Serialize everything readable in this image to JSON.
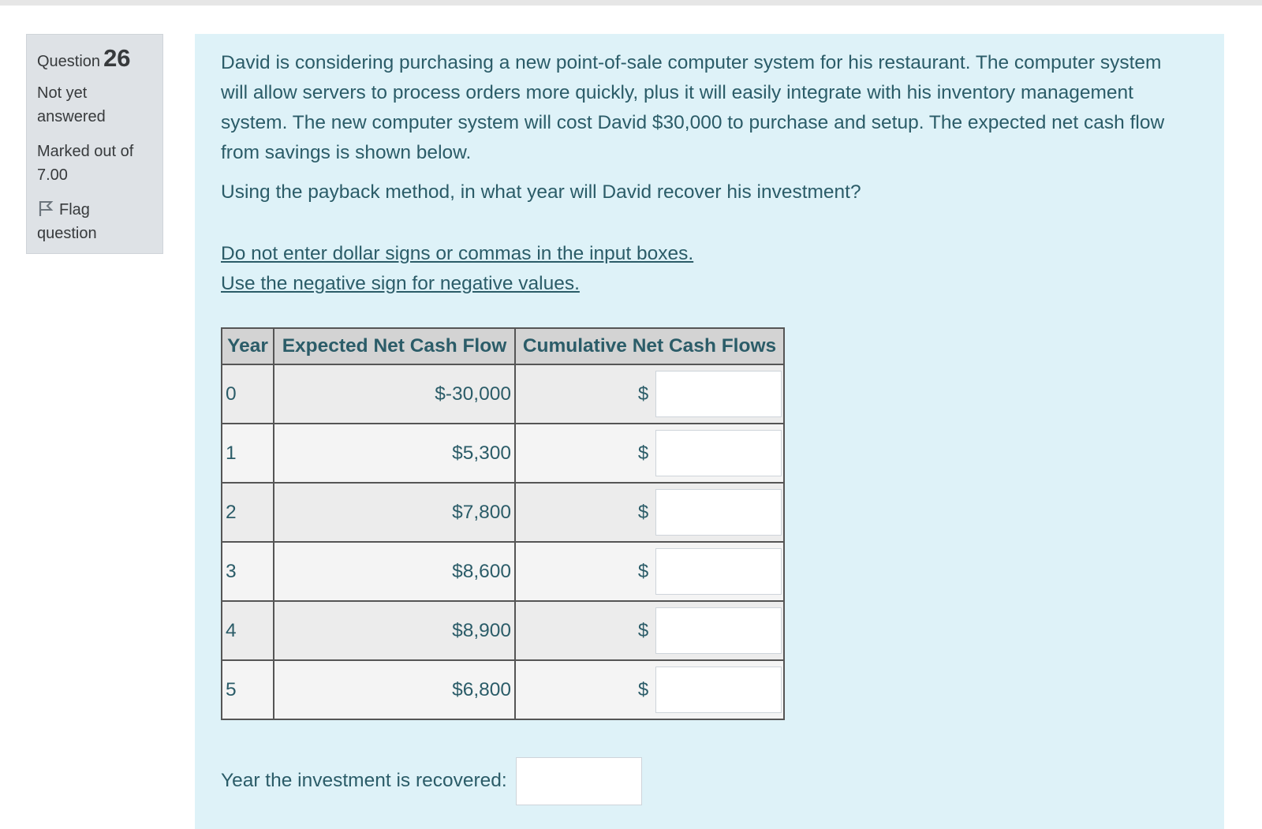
{
  "question": {
    "label": "Question",
    "number": "26",
    "state": "Not yet answered",
    "grade": "Marked out of 7.00",
    "flag_label": "Flag question"
  },
  "content": {
    "paragraph1": "David is considering purchasing a new point-of-sale computer system for his restaurant. The computer system will allow servers to process orders more quickly, plus it will easily integrate with his inventory management system. The new computer system will cost David $30,000 to purchase and setup. The expected net cash flow from savings is shown below.",
    "paragraph2": "Using the payback method, in what year will David recover his investment?",
    "note1": "Do not enter dollar signs or commas in the input boxes.",
    "note2": "Use the negative sign for negative values."
  },
  "table": {
    "headers": [
      "Year",
      "Expected Net Cash Flow",
      "Cumulative Net Cash Flows"
    ],
    "currency_symbol": "$",
    "rows": [
      {
        "year": "0",
        "flow": "$-30,000",
        "cumulative": ""
      },
      {
        "year": "1",
        "flow": "$5,300",
        "cumulative": ""
      },
      {
        "year": "2",
        "flow": "$7,800",
        "cumulative": ""
      },
      {
        "year": "3",
        "flow": "$8,600",
        "cumulative": ""
      },
      {
        "year": "4",
        "flow": "$8,900",
        "cumulative": ""
      },
      {
        "year": "5",
        "flow": "$6,800",
        "cumulative": ""
      }
    ]
  },
  "recover": {
    "label": "Year the investment is recovered:",
    "value": ""
  },
  "icons": {
    "flag": "flag-icon"
  },
  "colors": {
    "content_bg": "#def2f8",
    "info_bg": "#dee2e6",
    "text": "#2b5c68"
  }
}
